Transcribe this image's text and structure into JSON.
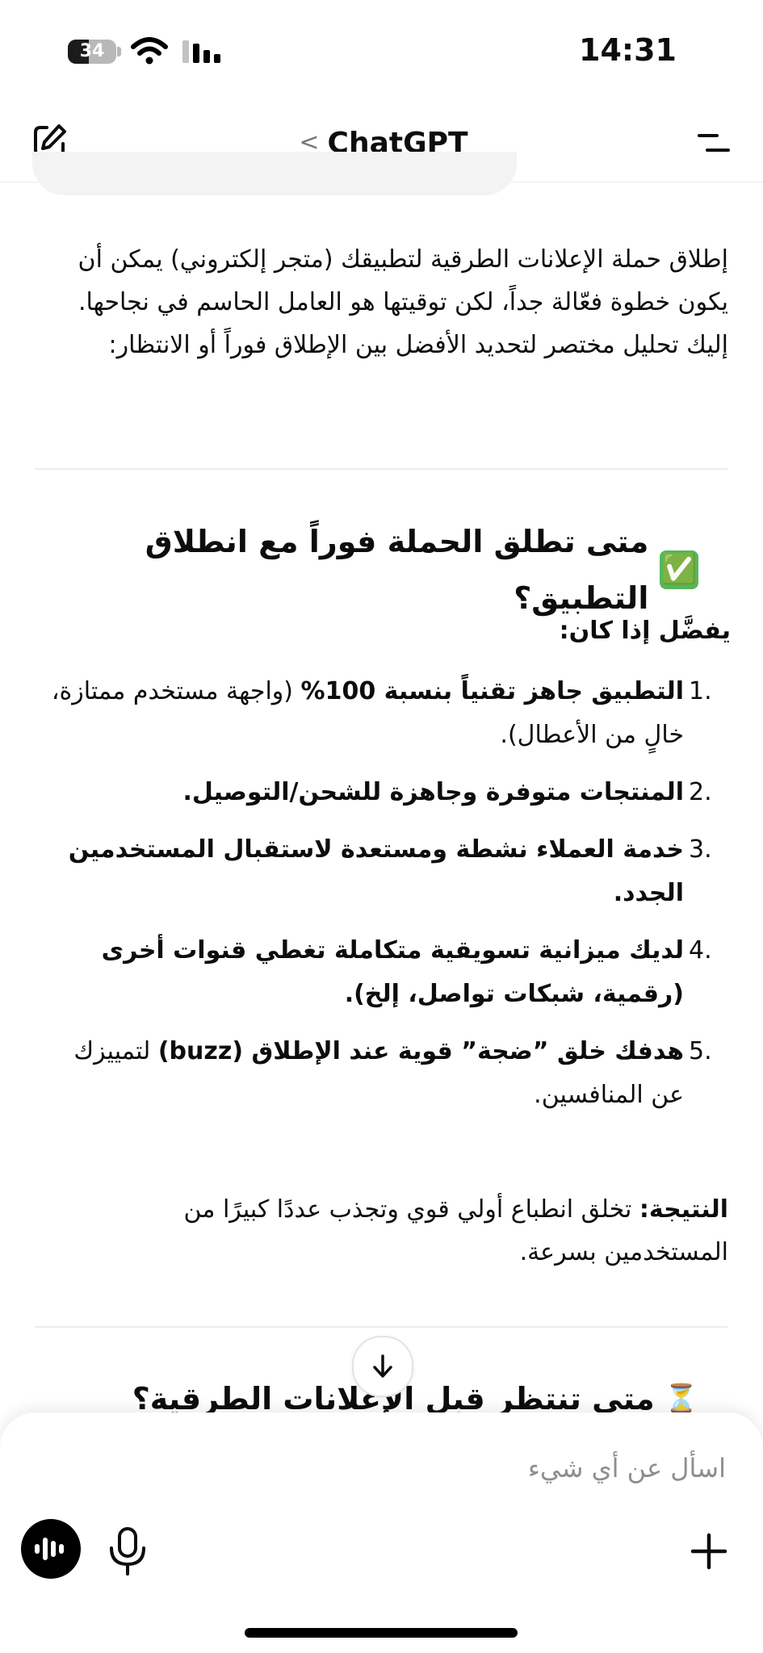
{
  "status_bar": {
    "time": "14:31",
    "battery_level": "34"
  },
  "nav": {
    "title": "ChatGPT",
    "back_chevron": "<",
    "new_chat_icon": "edit-icon",
    "menu_icon": "menu-icon"
  },
  "message": {
    "intro": "إطلاق حملة الإعلانات الطرقية لتطبيقك (متجر إلكتروني) يمكن أن يكون خطوة فعّالة جداً، لكن توقيتها هو العامل الحاسم في نجاحها. إليك تحليل مختصر لتحديد الأفضل بين الإطلاق فوراً أو الانتظار:",
    "heading1": "متى تطلق الحملة فوراً مع انطلاق التطبيق؟",
    "heading1_emoji": "✅",
    "subheading": "يفضَّل إذا كان:",
    "list": [
      {
        "num": "1.",
        "bold": "التطبيق جاهز تقنياً بنسبة 100%",
        "rest": " (واجهة مستخدم ممتازة، خالٍ من الأعطال)."
      },
      {
        "num": "2.",
        "bold": "المنتجات متوفرة وجاهزة للشحن/التوصيل.",
        "rest": ""
      },
      {
        "num": "3.",
        "bold": "خدمة العملاء نشطة ومستعدة لاستقبال المستخدمين الجدد.",
        "rest": ""
      },
      {
        "num": "4.",
        "bold": "لديك ميزانية تسويقية متكاملة تغطي قنوات أخرى (رقمية، شبكات تواصل، إلخ).",
        "rest": ""
      },
      {
        "num": "5.",
        "bold": "هدفك خلق ”ضجة” قوية عند الإطلاق (buzz)",
        "rest": " لتمييزك عن المنافسين."
      }
    ],
    "result_label": "النتيجة:",
    "result_text": " تخلق انطباع أولي قوي وتجذب عددًا كبيرًا من المستخدمين بسرعة.",
    "heading2": "متى تنتظر قبل الإعلانات الطرقية؟",
    "heading2_emoji": "⏳"
  },
  "composer": {
    "placeholder": "اسأل عن أي شيء"
  },
  "colors": {
    "accent_check": "#57b65b",
    "text": "#0d0d0d",
    "placeholder": "#8e8e8e"
  }
}
